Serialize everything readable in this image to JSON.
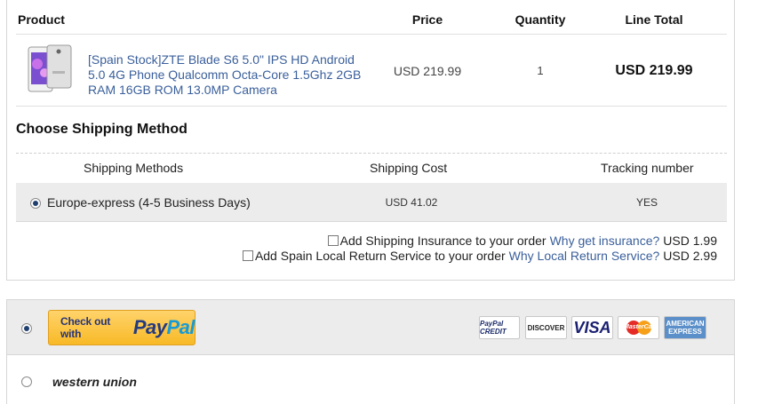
{
  "order": {
    "headers": {
      "product": "Product",
      "price": "Price",
      "quantity": "Quantity",
      "line_total": "Line Total"
    },
    "item": {
      "title": "[Spain Stock]ZTE Blade S6 5.0\" IPS HD Android 5.0 4G Phone Qualcomm Octa-Core 1.5Ghz 2GB RAM 16GB ROM 13.0MP Camera",
      "price": "USD 219.99",
      "quantity": "1",
      "line_total": "USD 219.99",
      "thumbnail_icon": "phone-thumbnail"
    }
  },
  "shipping": {
    "title": "Choose Shipping Method",
    "columns": {
      "methods": "Shipping Methods",
      "cost": "Shipping Cost",
      "tracking": "Tracking number"
    },
    "method": {
      "name": "Europe-express (4-5 Business Days)",
      "cost": "USD 41.02",
      "tracking": "YES",
      "selected": true
    },
    "insurance": {
      "label": "Add Shipping Insurance to your order",
      "link": "Why get insurance?",
      "price": "USD 1.99",
      "checked": false
    },
    "return_service": {
      "label": "Add Spain Local Return Service to your order",
      "link": "Why Local Return Service?",
      "price": "USD 2.99",
      "checked": false
    }
  },
  "payment": {
    "paypal": {
      "button_text": "Check out with",
      "logo_a": "Pay",
      "logo_b": "Pal",
      "selected": true
    },
    "cards": {
      "credit": "PayPal CREDIT",
      "discover": "DISCOVER",
      "visa": "VISA",
      "mastercard": "MasterCard",
      "amex": "AMERICAN EXPRESS"
    },
    "western_union": {
      "label": "western union",
      "selected": false
    }
  },
  "colors": {
    "link": "#3a5f9b",
    "row_bg": "#ececec",
    "paypal_yellow": "#f8b926",
    "paypal_navy": "#253b80",
    "paypal_blue": "#179bd7"
  }
}
